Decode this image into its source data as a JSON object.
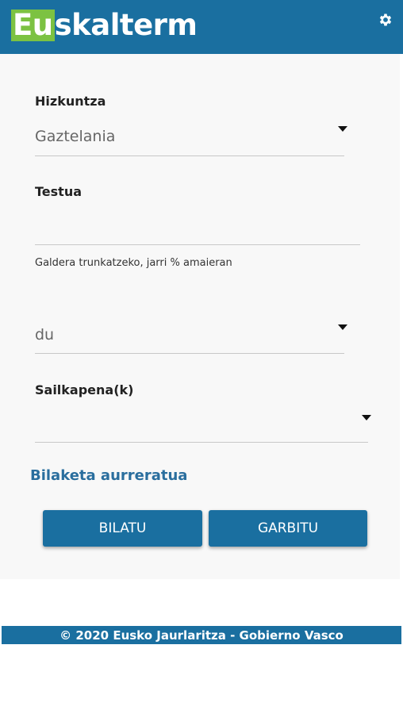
{
  "header": {
    "logo_prefix": "Eu",
    "logo_rest": "skalterm",
    "settings_icon": "gear-icon",
    "bg_color": "#1a6fa0",
    "logo_accent": "#7cc242"
  },
  "form": {
    "language": {
      "label": "Hizkuntza",
      "value": "Gaztelania"
    },
    "text": {
      "label": "Testua",
      "value": "",
      "hint": "Galdera trunkatzeko, jarri % amaieran"
    },
    "match": {
      "value": "du"
    },
    "classification": {
      "label": "Sailkapena(k)",
      "value": ""
    },
    "advanced_link": "Bilaketa aurreratua",
    "buttons": {
      "search": "BILATU",
      "clear": "GARBITU"
    }
  },
  "footer": {
    "text": "© 2020 Eusko Jaurlaritza - Gobierno Vasco"
  }
}
